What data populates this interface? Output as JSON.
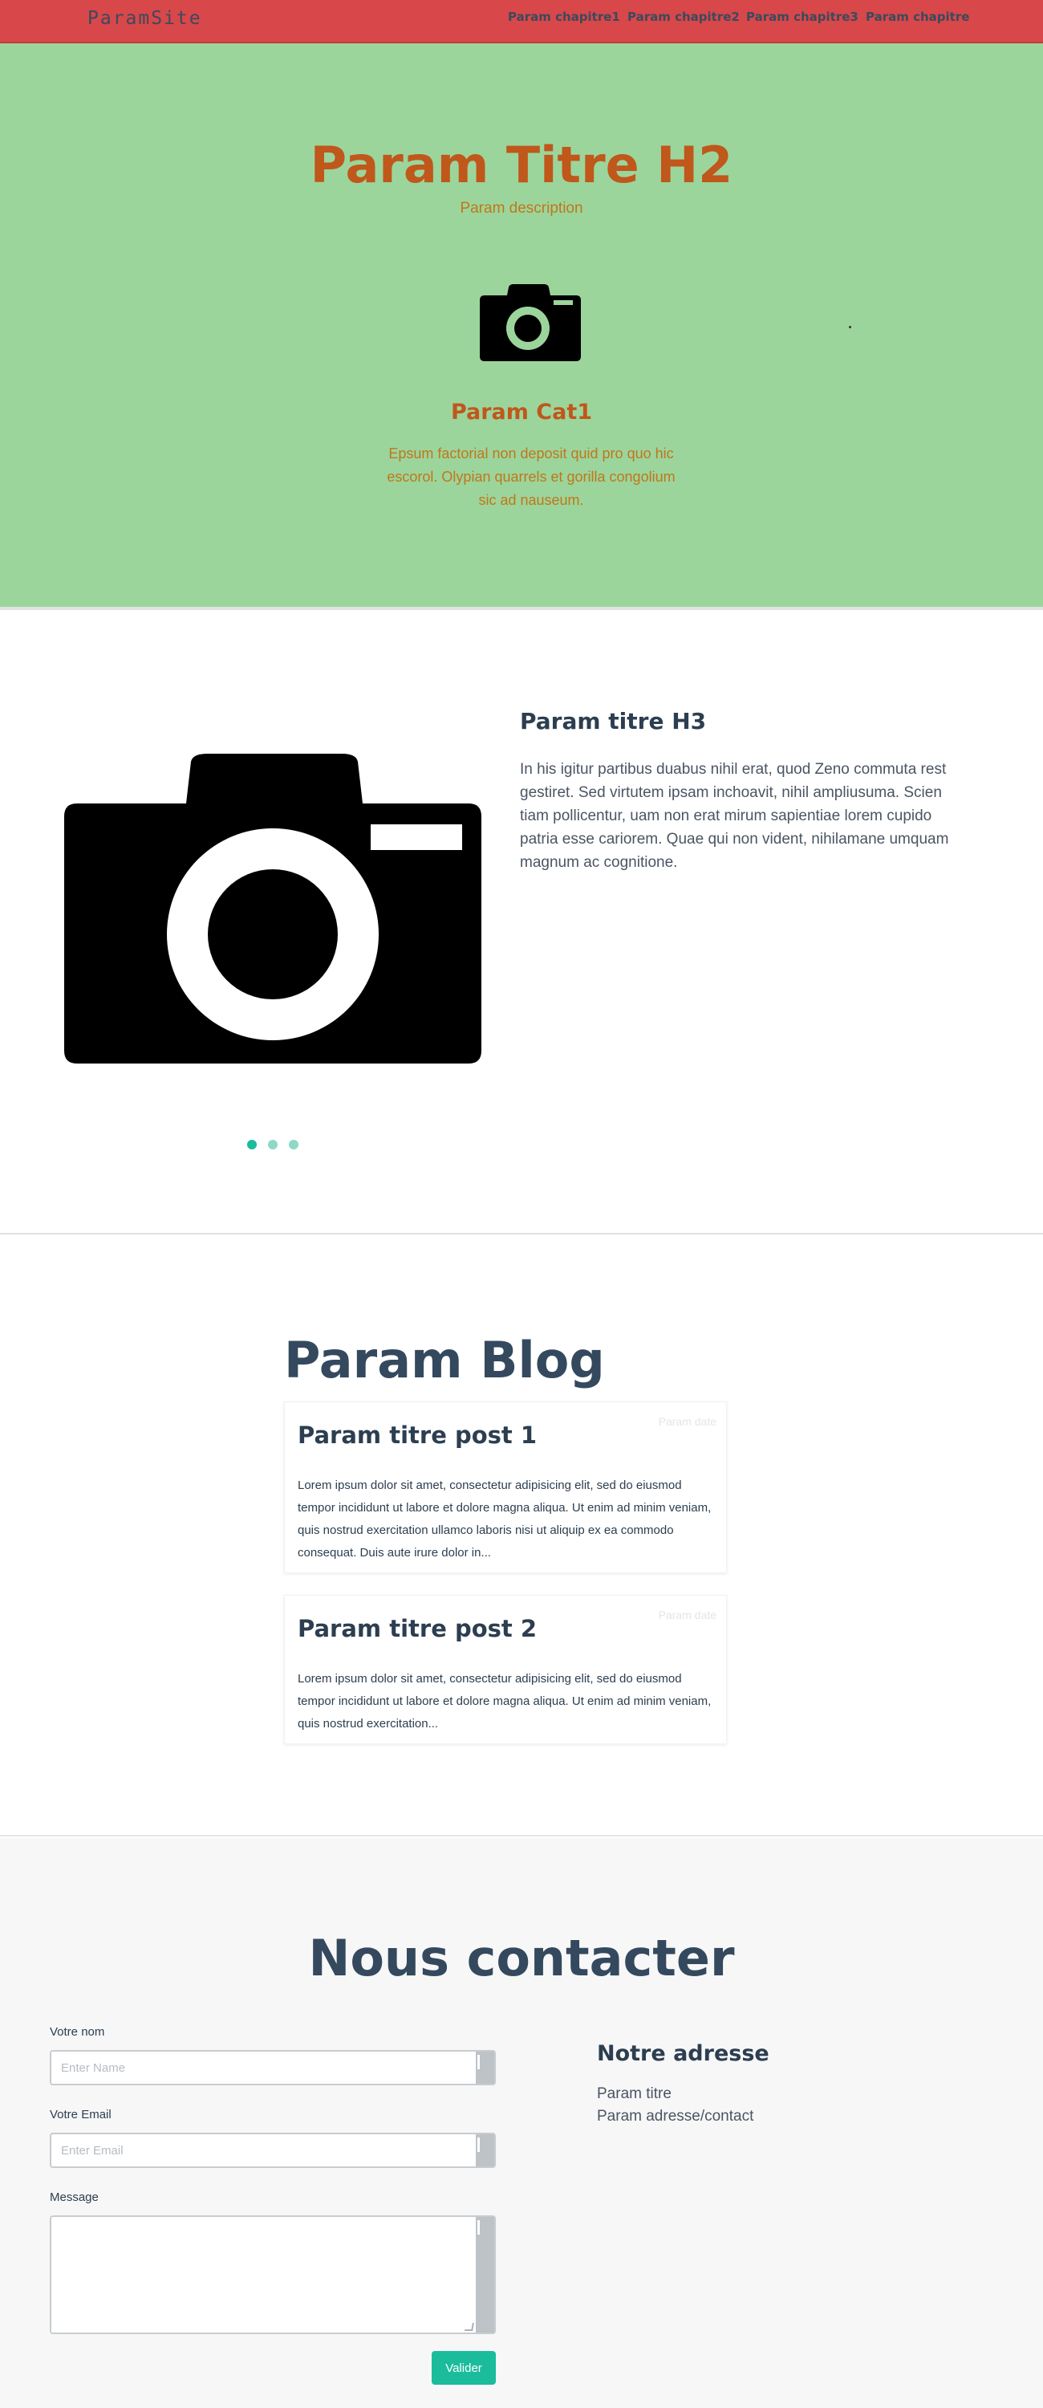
{
  "site": {
    "brand": "ParamSite"
  },
  "nav": {
    "links": [
      "Param chapitre1",
      "Param chapitre2",
      "Param chapitre3",
      "Param chapitre"
    ]
  },
  "hero": {
    "title": "Param Titre H2",
    "description": "Param description",
    "icon": "camera-icon",
    "category_title": "Param Cat1",
    "category_text": "Epsum factorial non deposit quid pro quo hic escorol. Olypian quarrels et gorilla congolium sic ad nauseum."
  },
  "feature": {
    "icon": "camera-icon",
    "title": "Param titre H3",
    "text": "In his igitur partibus duabus nihil erat, quod Zeno commuta rest gestiret. Sed virtutem ipsam inchoavit, nihil ampliusuma. Scien tiam pollicentur, uam non erat mirum sapientiae lorem cupido patria esse cariorem. Quae qui non vident, nihilamane umquam magnum ac cognitione.",
    "carousel": {
      "slides": 3,
      "active": 1
    }
  },
  "blog": {
    "title": "Param Blog",
    "posts": [
      {
        "date": "Param date",
        "title": "Param titre post 1",
        "body": "Lorem ipsum dolor sit amet, consectetur adipisicing elit, sed do eiusmod tempor incididunt ut labore et dolore magna aliqua. Ut enim ad minim veniam, quis nostrud exercitation ullamco laboris nisi ut aliquip ex ea commodo consequat. Duis aute irure dolor in..."
      },
      {
        "date": "Param date",
        "title": "Param titre post 2",
        "body": "Lorem ipsum dolor sit amet, consectetur adipisicing elit, sed do eiusmod tempor incididunt ut labore et dolore magna aliqua. Ut enim ad minim veniam, quis nostrud exercitation..."
      }
    ]
  },
  "contact": {
    "title": "Nous contacter",
    "name_label": "Votre nom",
    "name_placeholder": "Enter Name",
    "name_value": "",
    "email_label": "Votre Email",
    "email_placeholder": "Enter Email",
    "email_value": "",
    "message_label": "Message",
    "message_value": "",
    "submit_label": "Valider",
    "address_title": "Notre adresse",
    "address_lines": [
      "Param titre",
      "Param adresse/contact"
    ]
  },
  "colors": {
    "navbar": "#d8474a",
    "hero_bg": "#9cd59b",
    "hero_accent": "#c0571b",
    "heading": "#2c3e50",
    "button": "#1abc9c",
    "carousel_active": "#1abc9c",
    "carousel_inactive": "#8fd8c8"
  }
}
